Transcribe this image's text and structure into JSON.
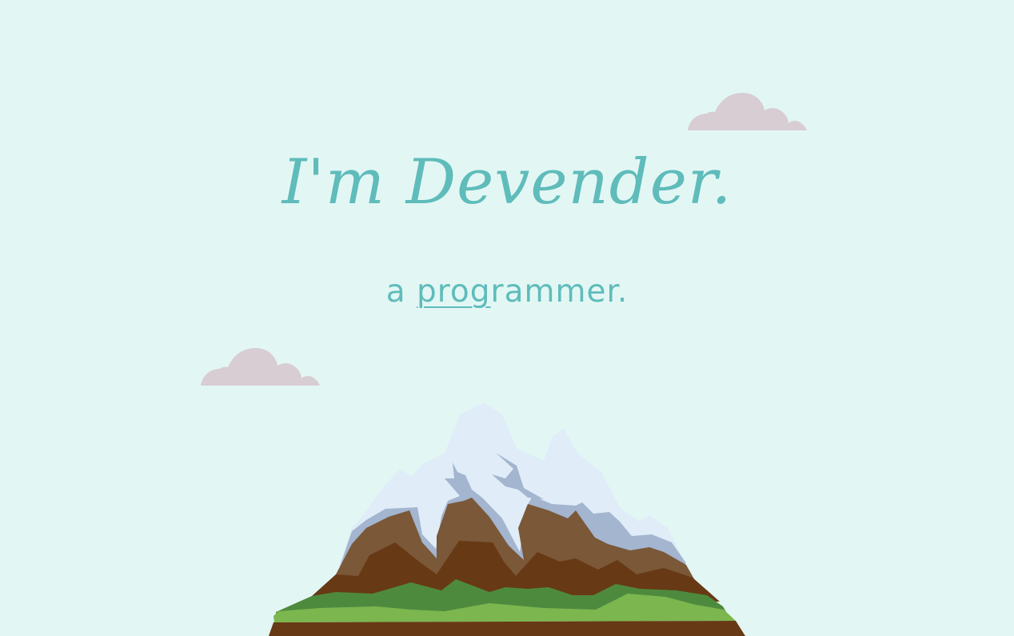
{
  "hero": {
    "title": "I'm Devender."
  },
  "tagline": {
    "prefix": "a ",
    "underlined": "prog",
    "suffix": "rammer."
  },
  "colors": {
    "background": "#e2f7f4",
    "accent": "#5fbcbb",
    "cloud": "#d8cdd2",
    "snow": "#e0edf8",
    "rock_shadow": "#a3b5cf",
    "earth_light": "#7a5838",
    "earth_dark": "#673915",
    "grass_dark": "#4e8a3e",
    "grass_light": "#7cb64f"
  },
  "icons": {
    "cloud_right": "cloud-icon",
    "cloud_left": "cloud-icon",
    "mountain": "mountain-illustration"
  }
}
